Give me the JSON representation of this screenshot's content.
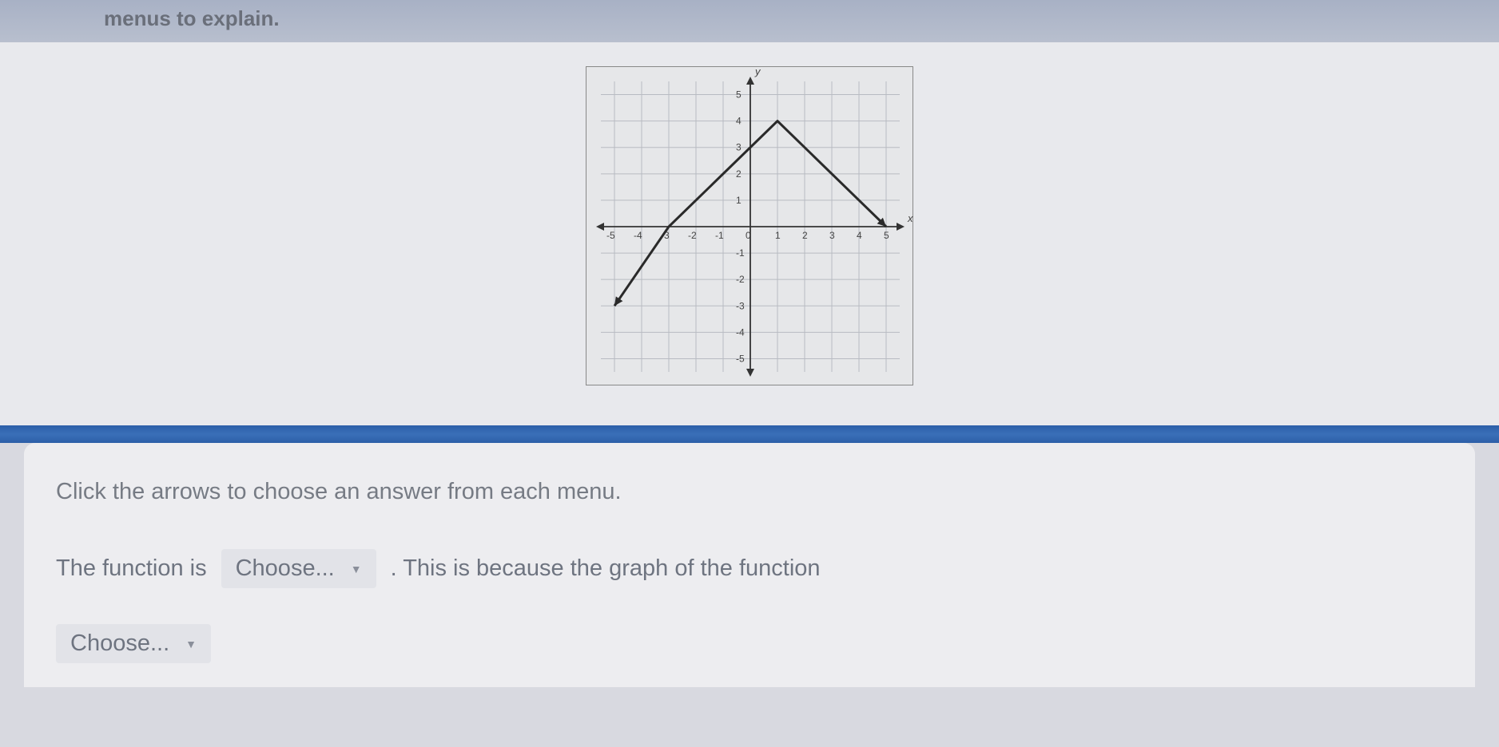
{
  "top_text": "menus to explain.",
  "instruction": "Click the arrows to choose an answer from each menu.",
  "sentence": {
    "part1": "The function is",
    "dropdown1": "Choose...",
    "part2": ". This is because the graph of the function",
    "dropdown2": "Choose..."
  },
  "chart_data": {
    "type": "line",
    "title": "",
    "xlabel": "x",
    "ylabel": "y",
    "xlim": [
      -5.5,
      5.5
    ],
    "ylim": [
      -5.5,
      5.5
    ],
    "x_ticks": [
      -5,
      -4,
      -3,
      -2,
      -1,
      0,
      1,
      2,
      3,
      4,
      5
    ],
    "y_ticks": [
      -5,
      -4,
      -3,
      -2,
      -1,
      0,
      1,
      2,
      3,
      4,
      5
    ],
    "series": [
      {
        "name": "function-graph",
        "x": [
          -5,
          -3,
          1,
          5
        ],
        "y": [
          -3,
          0,
          4,
          0
        ],
        "arrows": [
          {
            "at": "start",
            "direction": "down-left"
          },
          {
            "at": "end",
            "direction": "down-right"
          }
        ]
      }
    ],
    "grid": true
  }
}
